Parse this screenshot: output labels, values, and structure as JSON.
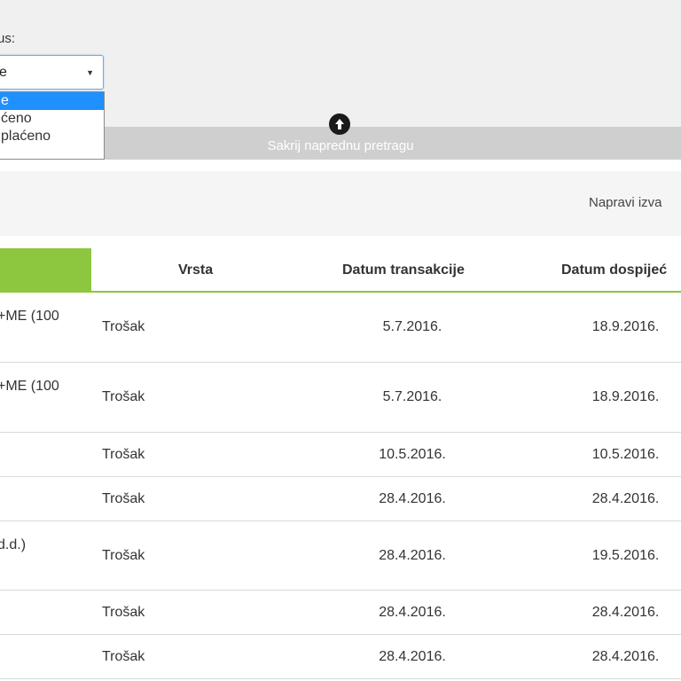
{
  "filter": {
    "status_label": "us:",
    "selected_value": "e",
    "options": [
      {
        "label": "e",
        "selected": true
      },
      {
        "label": "ćeno",
        "selected": false
      },
      {
        "label": "plaćeno",
        "selected": false
      }
    ],
    "toggle_label": "Sakrij naprednu pretragu"
  },
  "toolbar": {
    "export_label": "Napravi izva"
  },
  "table": {
    "columns": [
      "",
      "Vrsta",
      "Datum transakcije",
      "Datum dospijeć"
    ],
    "rows": [
      {
        "desc": "+ME (100",
        "vrsta": "Trošak",
        "trans": "5.7.2016.",
        "dosp": "18.9.2016."
      },
      {
        "desc": "+ME (100",
        "vrsta": "Trošak",
        "trans": "5.7.2016.",
        "dosp": "18.9.2016."
      },
      {
        "desc": "",
        "vrsta": "Trošak",
        "trans": "10.5.2016.",
        "dosp": "10.5.2016."
      },
      {
        "desc": "",
        "vrsta": "Trošak",
        "trans": "28.4.2016.",
        "dosp": "28.4.2016."
      },
      {
        "desc": "d.d.)",
        "vrsta": "Trošak",
        "trans": "28.4.2016.",
        "dosp": "19.5.2016."
      },
      {
        "desc": "",
        "vrsta": "Trošak",
        "trans": "28.4.2016.",
        "dosp": "28.4.2016."
      },
      {
        "desc": "",
        "vrsta": "Trošak",
        "trans": "28.4.2016.",
        "dosp": "28.4.2016."
      }
    ]
  },
  "colors": {
    "accent": "#8dc63f",
    "dropdown_highlight": "#1e90ff"
  }
}
